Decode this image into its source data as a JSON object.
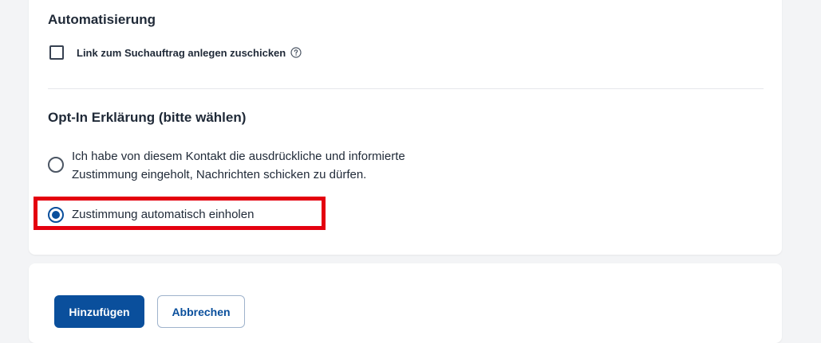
{
  "automation": {
    "title": "Automatisierung",
    "checkbox_label": "Link zum Suchauftrag anlegen zuschicken",
    "checkbox_checked": false,
    "help_icon": "question-circle-icon"
  },
  "optin": {
    "title": "Opt-In Erklärung (bitte wählen)",
    "options": [
      {
        "label": "Ich habe von diesem Kontakt die ausdrückliche und informierte Zustimmung eingeholt, Nachrichten schicken zu dürfen.",
        "selected": false
      },
      {
        "label": "Zustimmung automatisch einholen",
        "selected": true
      }
    ]
  },
  "actions": {
    "add_label": "Hinzufügen",
    "cancel_label": "Abbrechen"
  },
  "colors": {
    "primary": "#0a4f9c",
    "highlight": "#e4000f",
    "background": "#f3f4f6",
    "card": "#ffffff"
  }
}
